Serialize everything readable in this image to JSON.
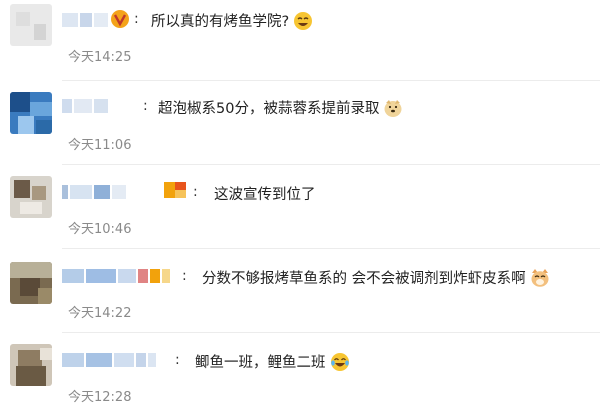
{
  "comments": [
    {
      "text": "所以真的有烤鱼学院?",
      "emoji": "laughing-face-icon",
      "time": "今天14:25"
    },
    {
      "text": "超泡椒系50分，被蒜蓉系提前录取",
      "emoji": "doge-face-icon",
      "time": "今天11:06"
    },
    {
      "text": "这波宣传到位了",
      "emoji": "",
      "time": "今天10:46"
    },
    {
      "text": "分数不够报烤草鱼系的 会不会被调剂到炸虾皮系啊",
      "emoji": "cat-face-icon",
      "time": "今天14:22"
    },
    {
      "text": "鲫鱼一班，鲤鱼二班",
      "emoji": "tears-of-joy-icon",
      "time": "今天12:28"
    }
  ],
  "colon": ":",
  "colors": {
    "time": "#8a8a8a",
    "text": "#222222",
    "divider": "#ececec",
    "badge": "#f2a20c"
  }
}
